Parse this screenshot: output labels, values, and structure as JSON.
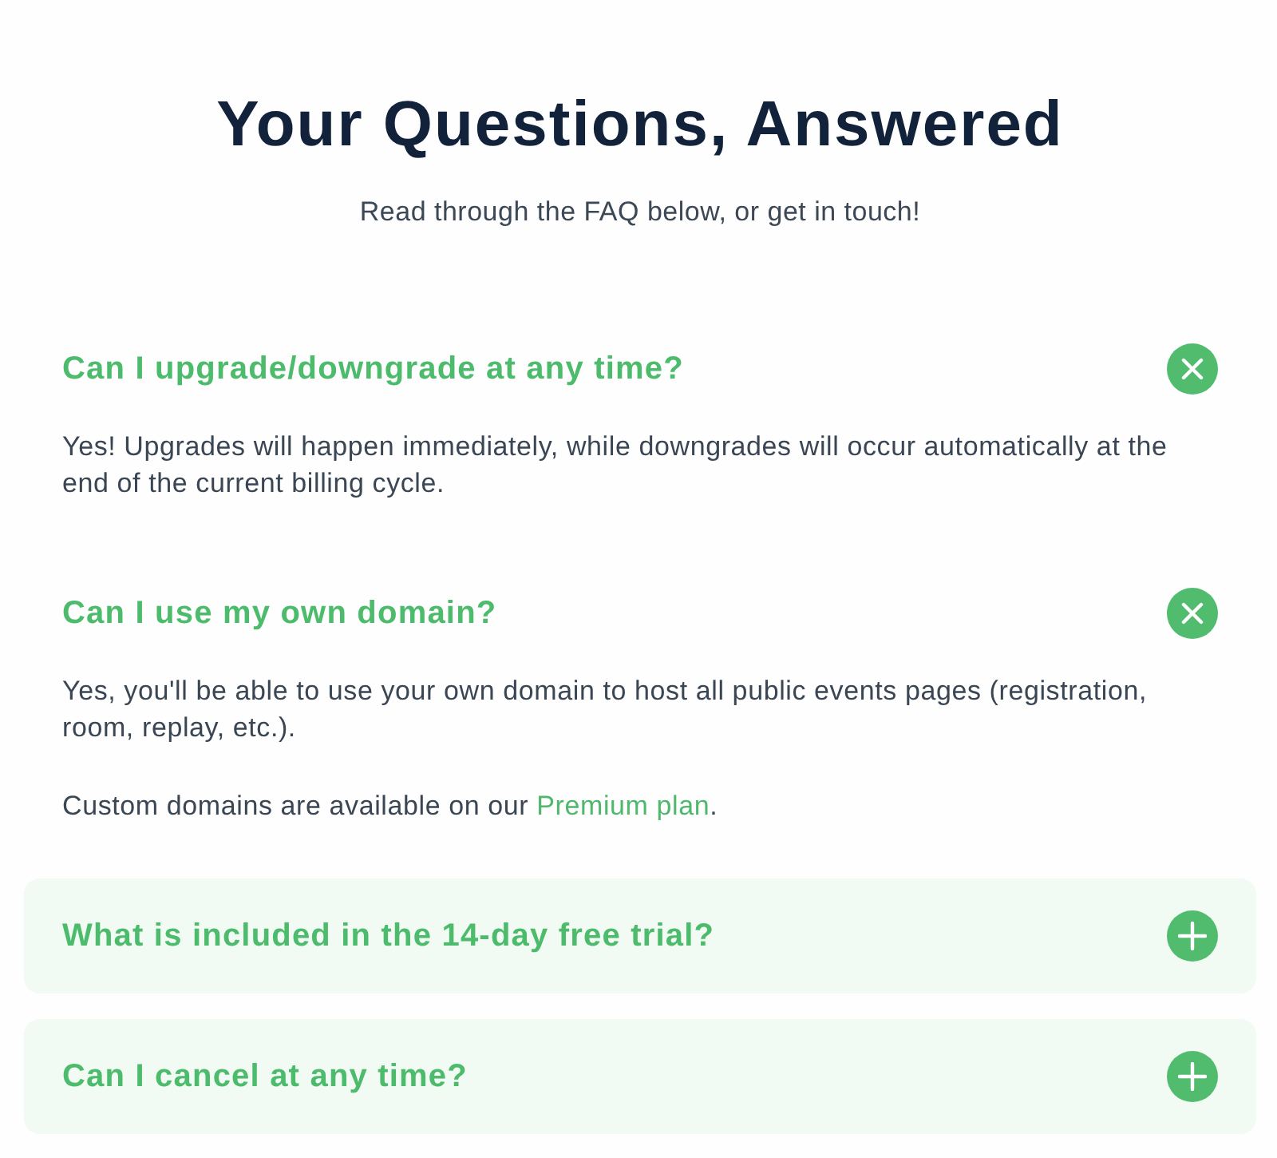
{
  "header": {
    "title": "Your Questions, Answered",
    "subtitle": "Read through the FAQ below, or get in touch!"
  },
  "faq": [
    {
      "question": "Can I upgrade/downgrade at any time?",
      "expanded": true,
      "answer": [
        [
          {
            "kind": "text",
            "text": "Yes! Upgrades will happen immediately, while downgrades will occur automatically at the end of the current billing cycle."
          }
        ]
      ]
    },
    {
      "question": "Can I use my own domain?",
      "expanded": true,
      "answer": [
        [
          {
            "kind": "text",
            "text": "Yes, you'll be able to use your own domain to host all public events pages (registration, room, replay, etc.)."
          }
        ],
        [
          {
            "kind": "text",
            "text": "Custom domains are available on our "
          },
          {
            "kind": "link",
            "text": "Premium plan"
          },
          {
            "kind": "text",
            "text": "."
          }
        ]
      ]
    },
    {
      "question": "What is included in the 14-day free trial?",
      "expanded": false
    },
    {
      "question": "Can I cancel at any time?",
      "expanded": false
    }
  ]
}
